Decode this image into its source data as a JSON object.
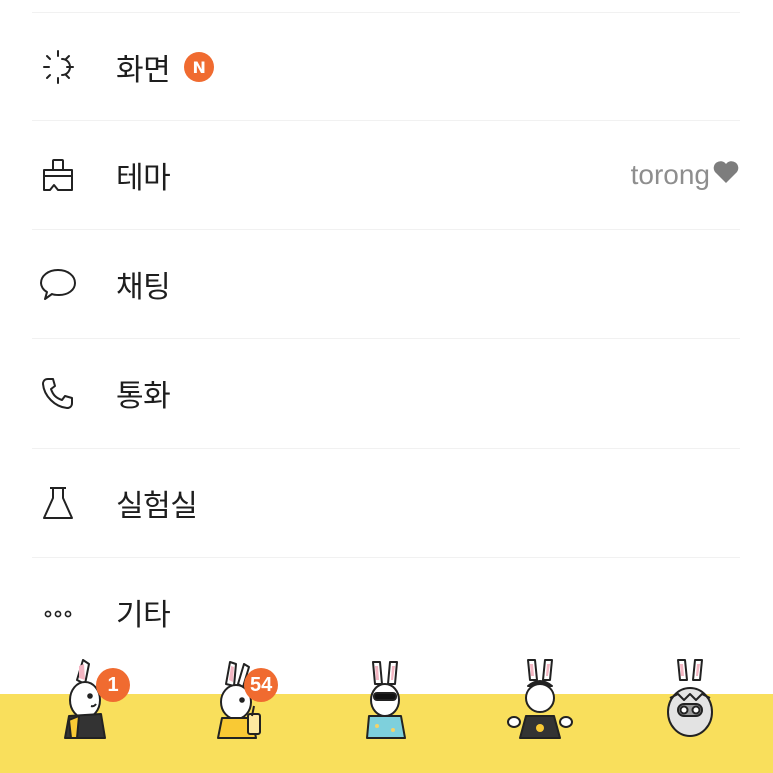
{
  "settings": {
    "items": [
      {
        "label": "화면",
        "icon": "sun-icon",
        "badge": "N"
      },
      {
        "label": "테마",
        "icon": "paint-brush-icon",
        "value": "torong",
        "value_icon": "heart-icon"
      },
      {
        "label": "채팅",
        "icon": "chat-bubble-icon"
      },
      {
        "label": "통화",
        "icon": "phone-icon"
      },
      {
        "label": "실험실",
        "icon": "flask-icon"
      },
      {
        "label": "기타",
        "icon": "more-dots-icon"
      }
    ]
  },
  "tabbar": {
    "background": "#f9df5c",
    "tabs": [
      {
        "name": "friends",
        "icon": "rabbit-overalls-icon",
        "badge": "1"
      },
      {
        "name": "chats",
        "icon": "rabbit-drink-icon",
        "badge": "54"
      },
      {
        "name": "view",
        "icon": "rabbit-sunglasses-icon"
      },
      {
        "name": "shopping",
        "icon": "rabbit-cap-icon"
      },
      {
        "name": "more",
        "icon": "rabbit-egg-icon"
      }
    ]
  },
  "colors": {
    "accent": "#f06b30",
    "muted": "#8e8e8e",
    "text": "#1e1e1e"
  }
}
